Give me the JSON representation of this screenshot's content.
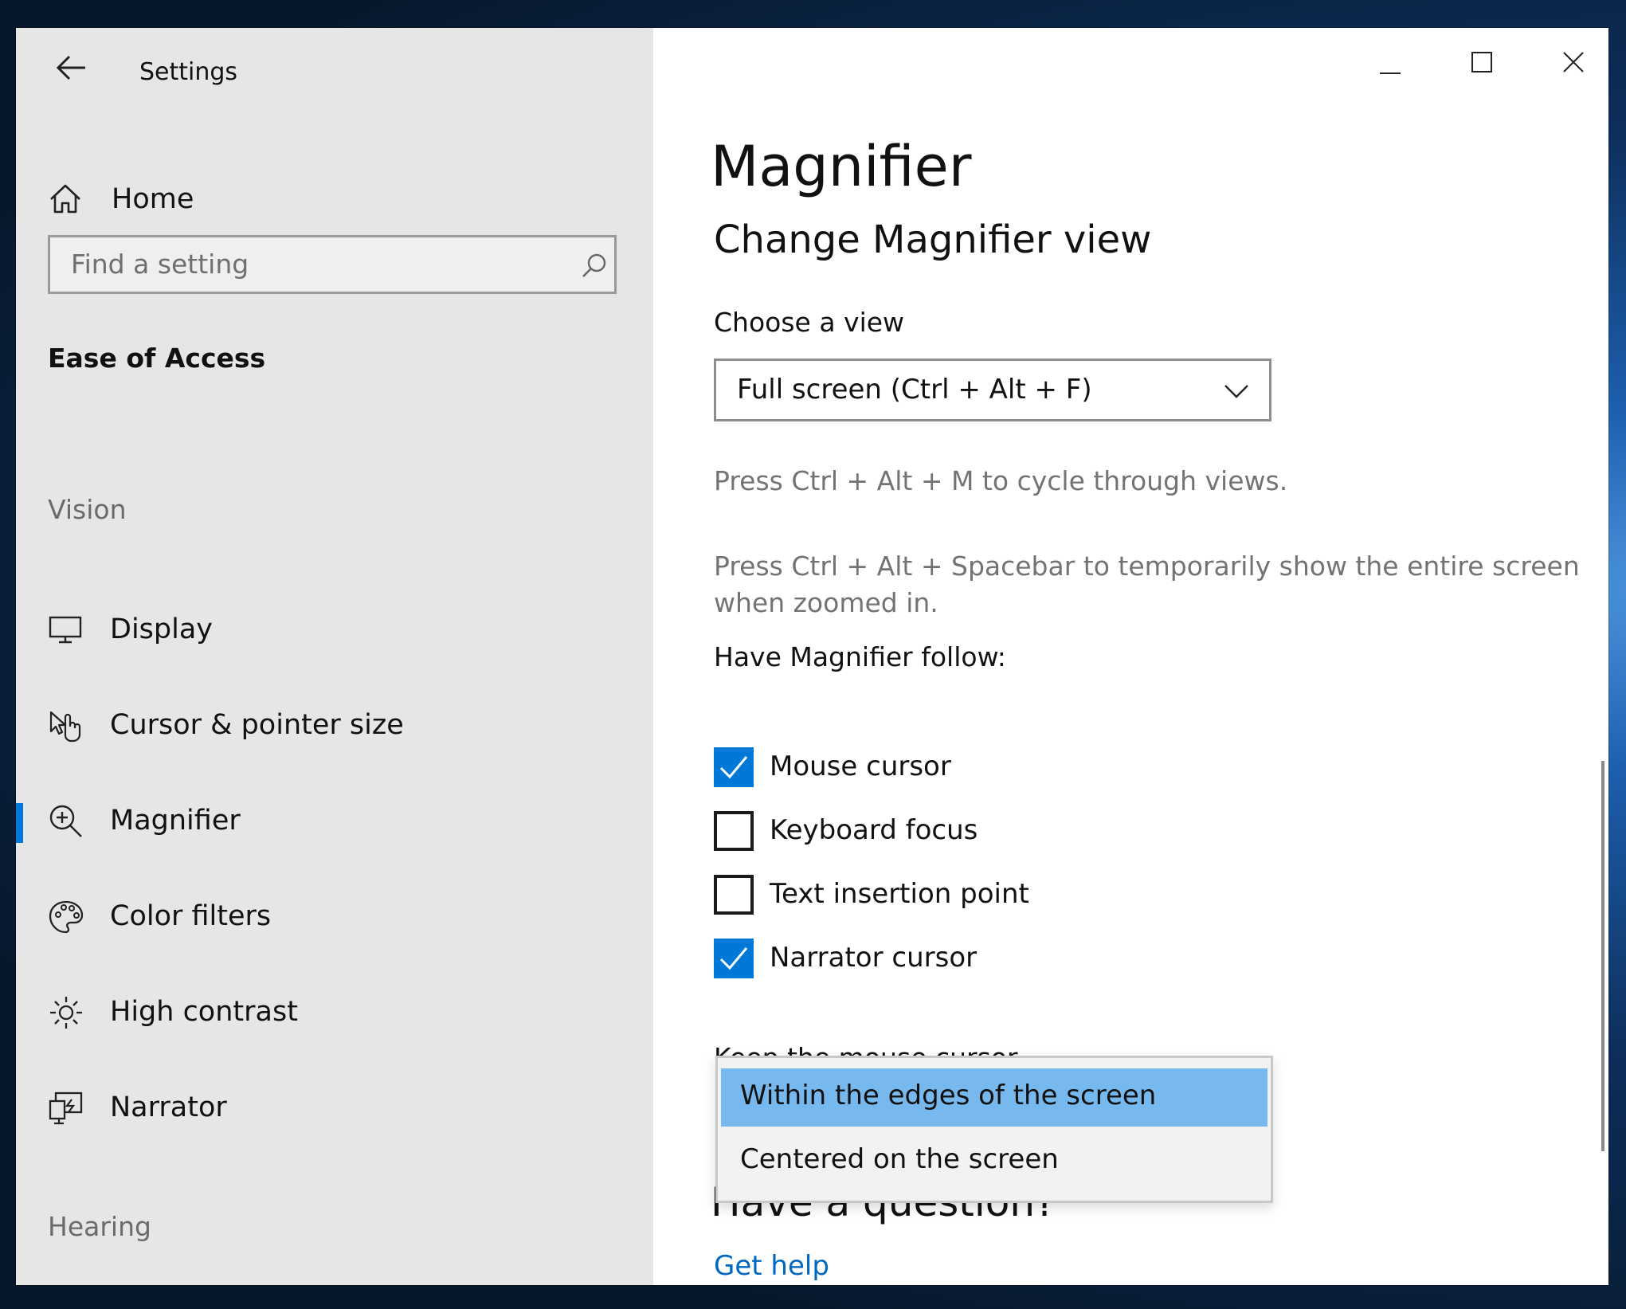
{
  "window": {
    "app_title": "Settings"
  },
  "sidebar": {
    "home_label": "Home",
    "search_placeholder": "Find a setting",
    "section_title": "Ease of Access",
    "group_vision": "Vision",
    "group_hearing": "Hearing",
    "items": [
      {
        "label": "Display",
        "icon": "monitor-icon"
      },
      {
        "label": "Cursor & pointer size",
        "icon": "pointer-hand-icon"
      },
      {
        "label": "Magnifier",
        "icon": "magnifier-icon",
        "active": true
      },
      {
        "label": "Color filters",
        "icon": "palette-icon"
      },
      {
        "label": "High contrast",
        "icon": "sun-icon"
      },
      {
        "label": "Narrator",
        "icon": "narrator-icon"
      }
    ]
  },
  "main": {
    "title": "Magnifier",
    "subtitle": "Change Magnifier view",
    "choose_view_label": "Choose a view",
    "view_selected": "Full screen (Ctrl + Alt + F)",
    "hint_cycle": "Press Ctrl + Alt + M to cycle through views.",
    "hint_spacebar": "Press Ctrl + Alt + Spacebar to temporarily show the entire screen when zoomed in.",
    "follow_label": "Have Magnifier follow:",
    "follow_options": [
      {
        "label": "Mouse cursor",
        "checked": true
      },
      {
        "label": "Keyboard focus",
        "checked": false
      },
      {
        "label": "Text insertion point",
        "checked": false
      },
      {
        "label": "Narrator cursor",
        "checked": true
      }
    ],
    "keep_cursor_label": "Keep the mouse cursor",
    "keep_cursor_options": [
      {
        "label": "Within the edges of the screen",
        "selected": true
      },
      {
        "label": "Centered on the screen",
        "selected": false
      }
    ],
    "question_heading": "Have a question?",
    "get_help_link": "Get help"
  },
  "colors": {
    "accent": "#0078d7",
    "sidebar_bg": "#e6e6e6",
    "dropdown_selected": "#77b9ee",
    "link": "#0067c0"
  }
}
